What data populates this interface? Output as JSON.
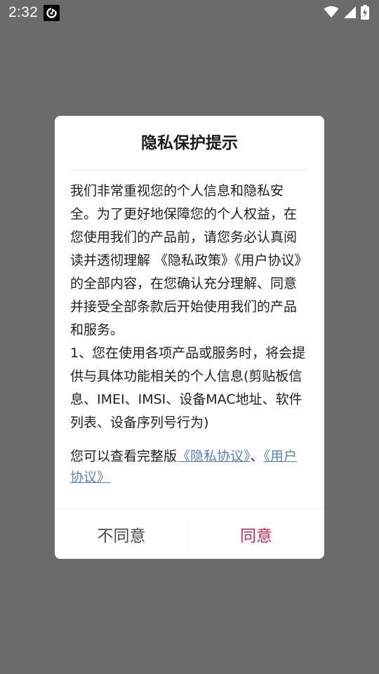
{
  "status_bar": {
    "time": "2:32",
    "icons": [
      "notification-app-icon",
      "wifi-icon",
      "cell-signal-icon",
      "battery-charging-icon"
    ]
  },
  "dialog": {
    "title": "隐私保护提示",
    "body": "我们非常重视您的个人信息和隐私安全。为了更好地保障您的个人权益，在您使用我们的产品前，请您务必认真阅读并透彻理解 《隐私政策》《用户协议》的全部内容，在您确认充分理解、同意并接受全部条款后开始使用我们的产品和服务。\n1、您在使用各项产品或服务时，将会提供与具体功能相关的个人信息(剪贴板信息、IMEI、IMSI、设备MAC地址、软件列表、设备序列号行为)",
    "links_prefix": "您可以查看完整版",
    "privacy_link": "《隐私协议》",
    "separator": "、",
    "user_link": "《用户协议》",
    "disagree_label": "不同意",
    "agree_label": "同意"
  },
  "colors": {
    "backdrop": "#6b6b6b",
    "link": "#5b7fc2",
    "agree": "#d52b53"
  }
}
